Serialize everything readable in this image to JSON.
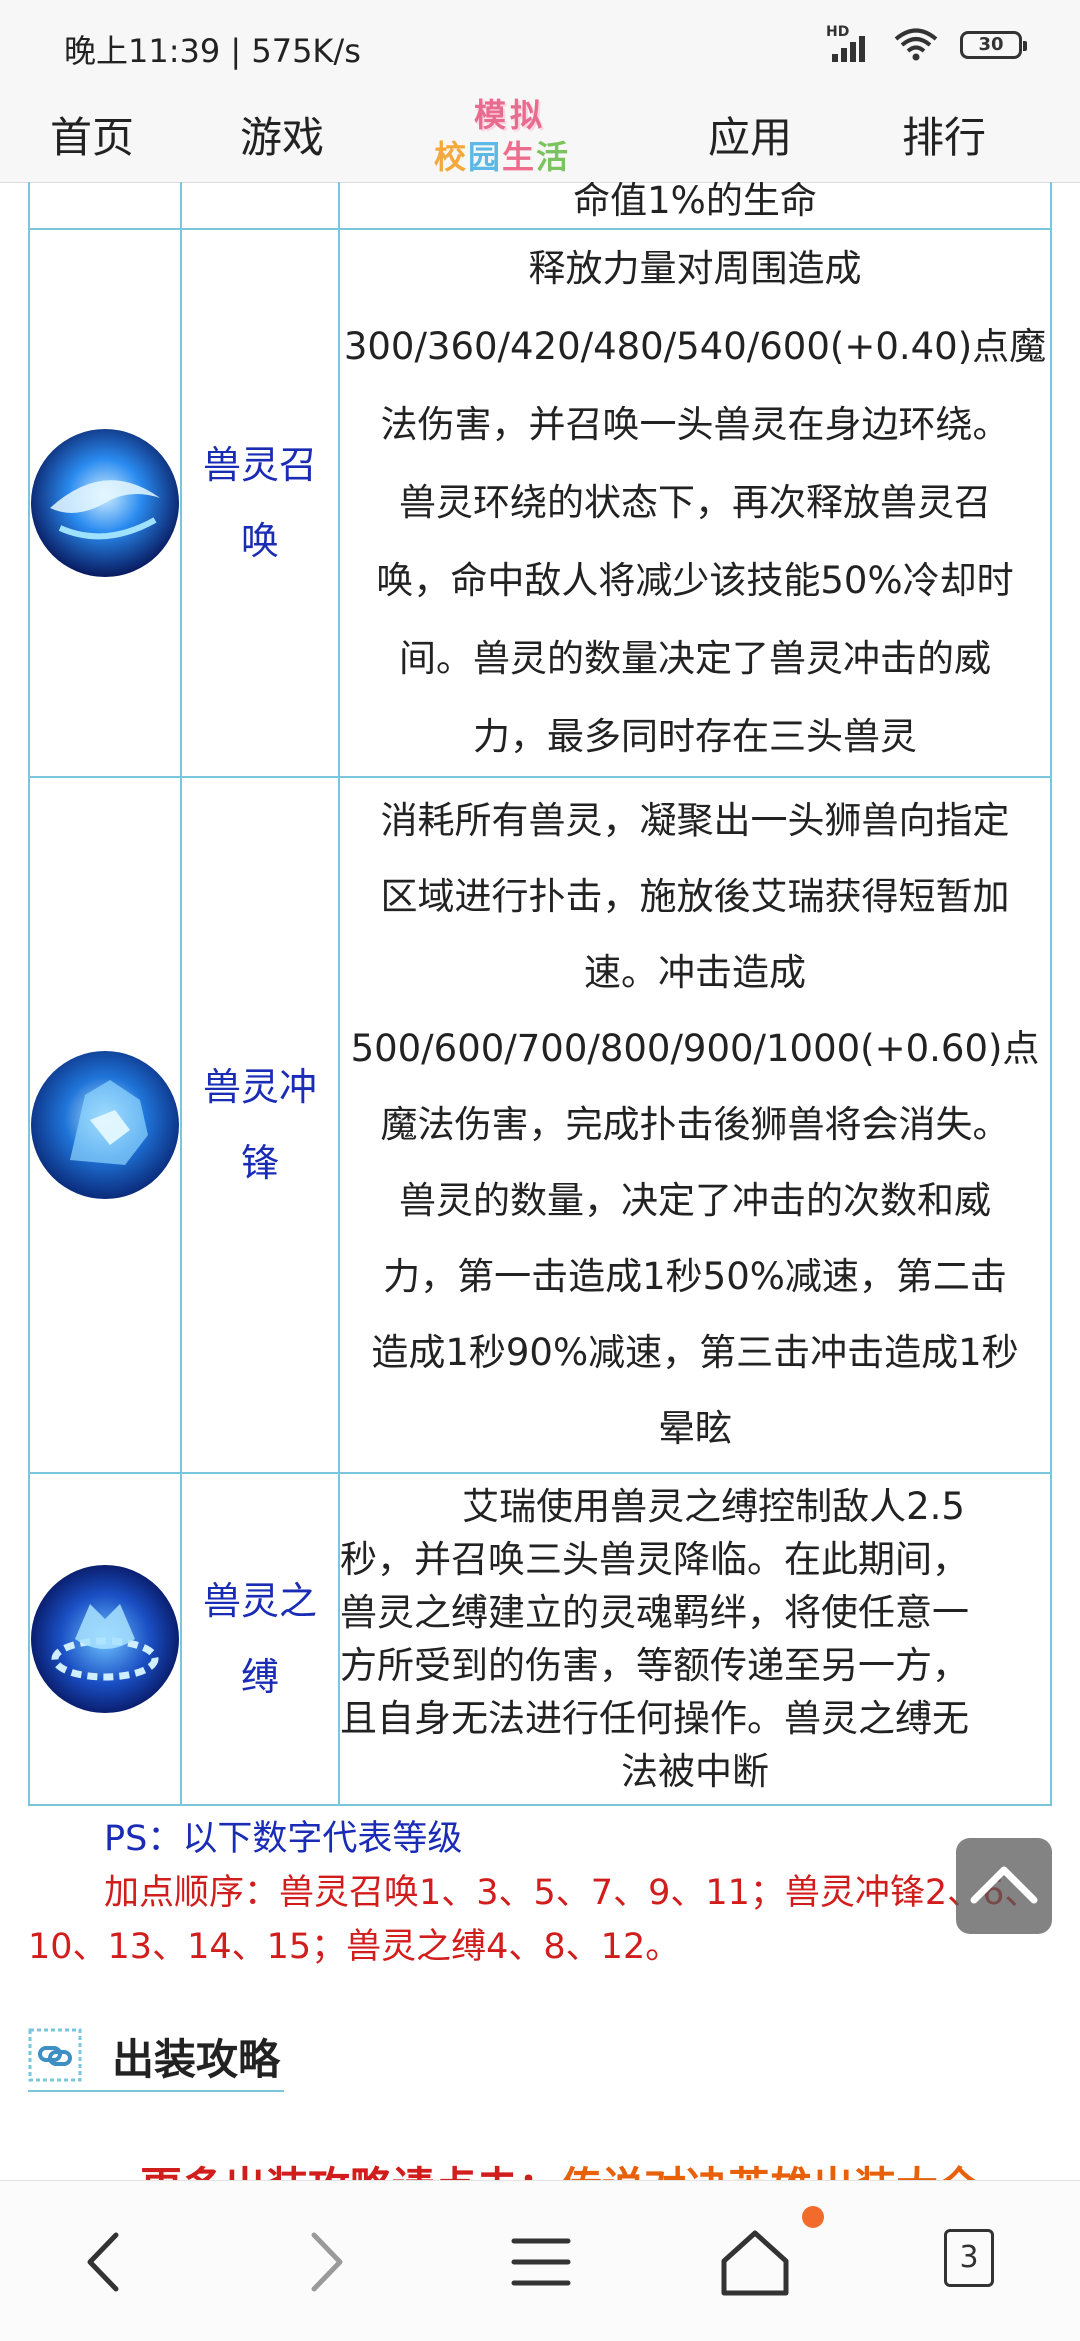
{
  "status_bar": {
    "time": "晚上11:39 | 575K/s",
    "signal_label": "HD",
    "battery": "30"
  },
  "top_nav": {
    "items": [
      "首页",
      "游戏",
      "应用",
      "排行"
    ],
    "logo_line1": "模拟",
    "logo_line2": [
      "校",
      "园",
      "生",
      "活"
    ]
  },
  "table": {
    "top_fragment": "命值1%的生命",
    "rows": [
      {
        "icon": "beast-summon-skill-icon",
        "name_lines": [
          "兽灵召",
          "唤"
        ],
        "desc_lines": [
          "释放力量对周围造成",
          "300/360/420/480/540/600(+0.40)点魔",
          "法伤害，并召唤一头兽灵在身边环绕。",
          "兽灵环绕的状态下，再次释放兽灵召",
          "唤，命中敌人将减少该技能50%冷却时",
          "间。兽灵的数量决定了兽灵冲击的威",
          "力，最多同时存在三头兽灵"
        ]
      },
      {
        "icon": "beast-charge-skill-icon",
        "name_lines": [
          "兽灵冲",
          "锋"
        ],
        "desc_lines": [
          "消耗所有兽灵，凝聚出一头狮兽向指定",
          "区域进行扑击，施放後艾瑞获得短暂加",
          "速。冲击造成",
          "500/600/700/800/900/1000(+0.60)点",
          "魔法伤害，完成扑击後狮兽将会消失。",
          "兽灵的数量，决定了冲击的次数和威",
          "力，第一击造成1秒50%减速，第二击",
          "造成1秒90%减速，第三击冲击造成1秒",
          "晕眩"
        ]
      },
      {
        "icon": "beast-bond-skill-icon",
        "name_lines": [
          "兽灵之",
          "缚"
        ],
        "desc_lines": [
          "　艾瑞使用兽灵之缚控制敌人2.5",
          "秒，并召唤三头兽灵降临。在此期间，",
          "兽灵之缚建立的灵魂羁绊，将使任意一",
          "方所受到的伤害，等额传递至另一方，",
          "且自身无法进行任何操作。兽灵之缚无",
          "法被中断"
        ]
      }
    ]
  },
  "ps_text": "PS：以下数字代表等级",
  "order_text": "加点顺序：兽灵召唤1、3、5、7、9、11；兽灵冲锋2、6、10、13、14、15；兽灵之缚4、8、12。",
  "section": {
    "icon": "link-icon",
    "title": "出装攻略"
  },
  "more_line": {
    "prefix": "更多出装攻略请点击：",
    "link": "传说对决英雄出装大全"
  },
  "bottom_bar": {
    "tab_count": "3"
  }
}
